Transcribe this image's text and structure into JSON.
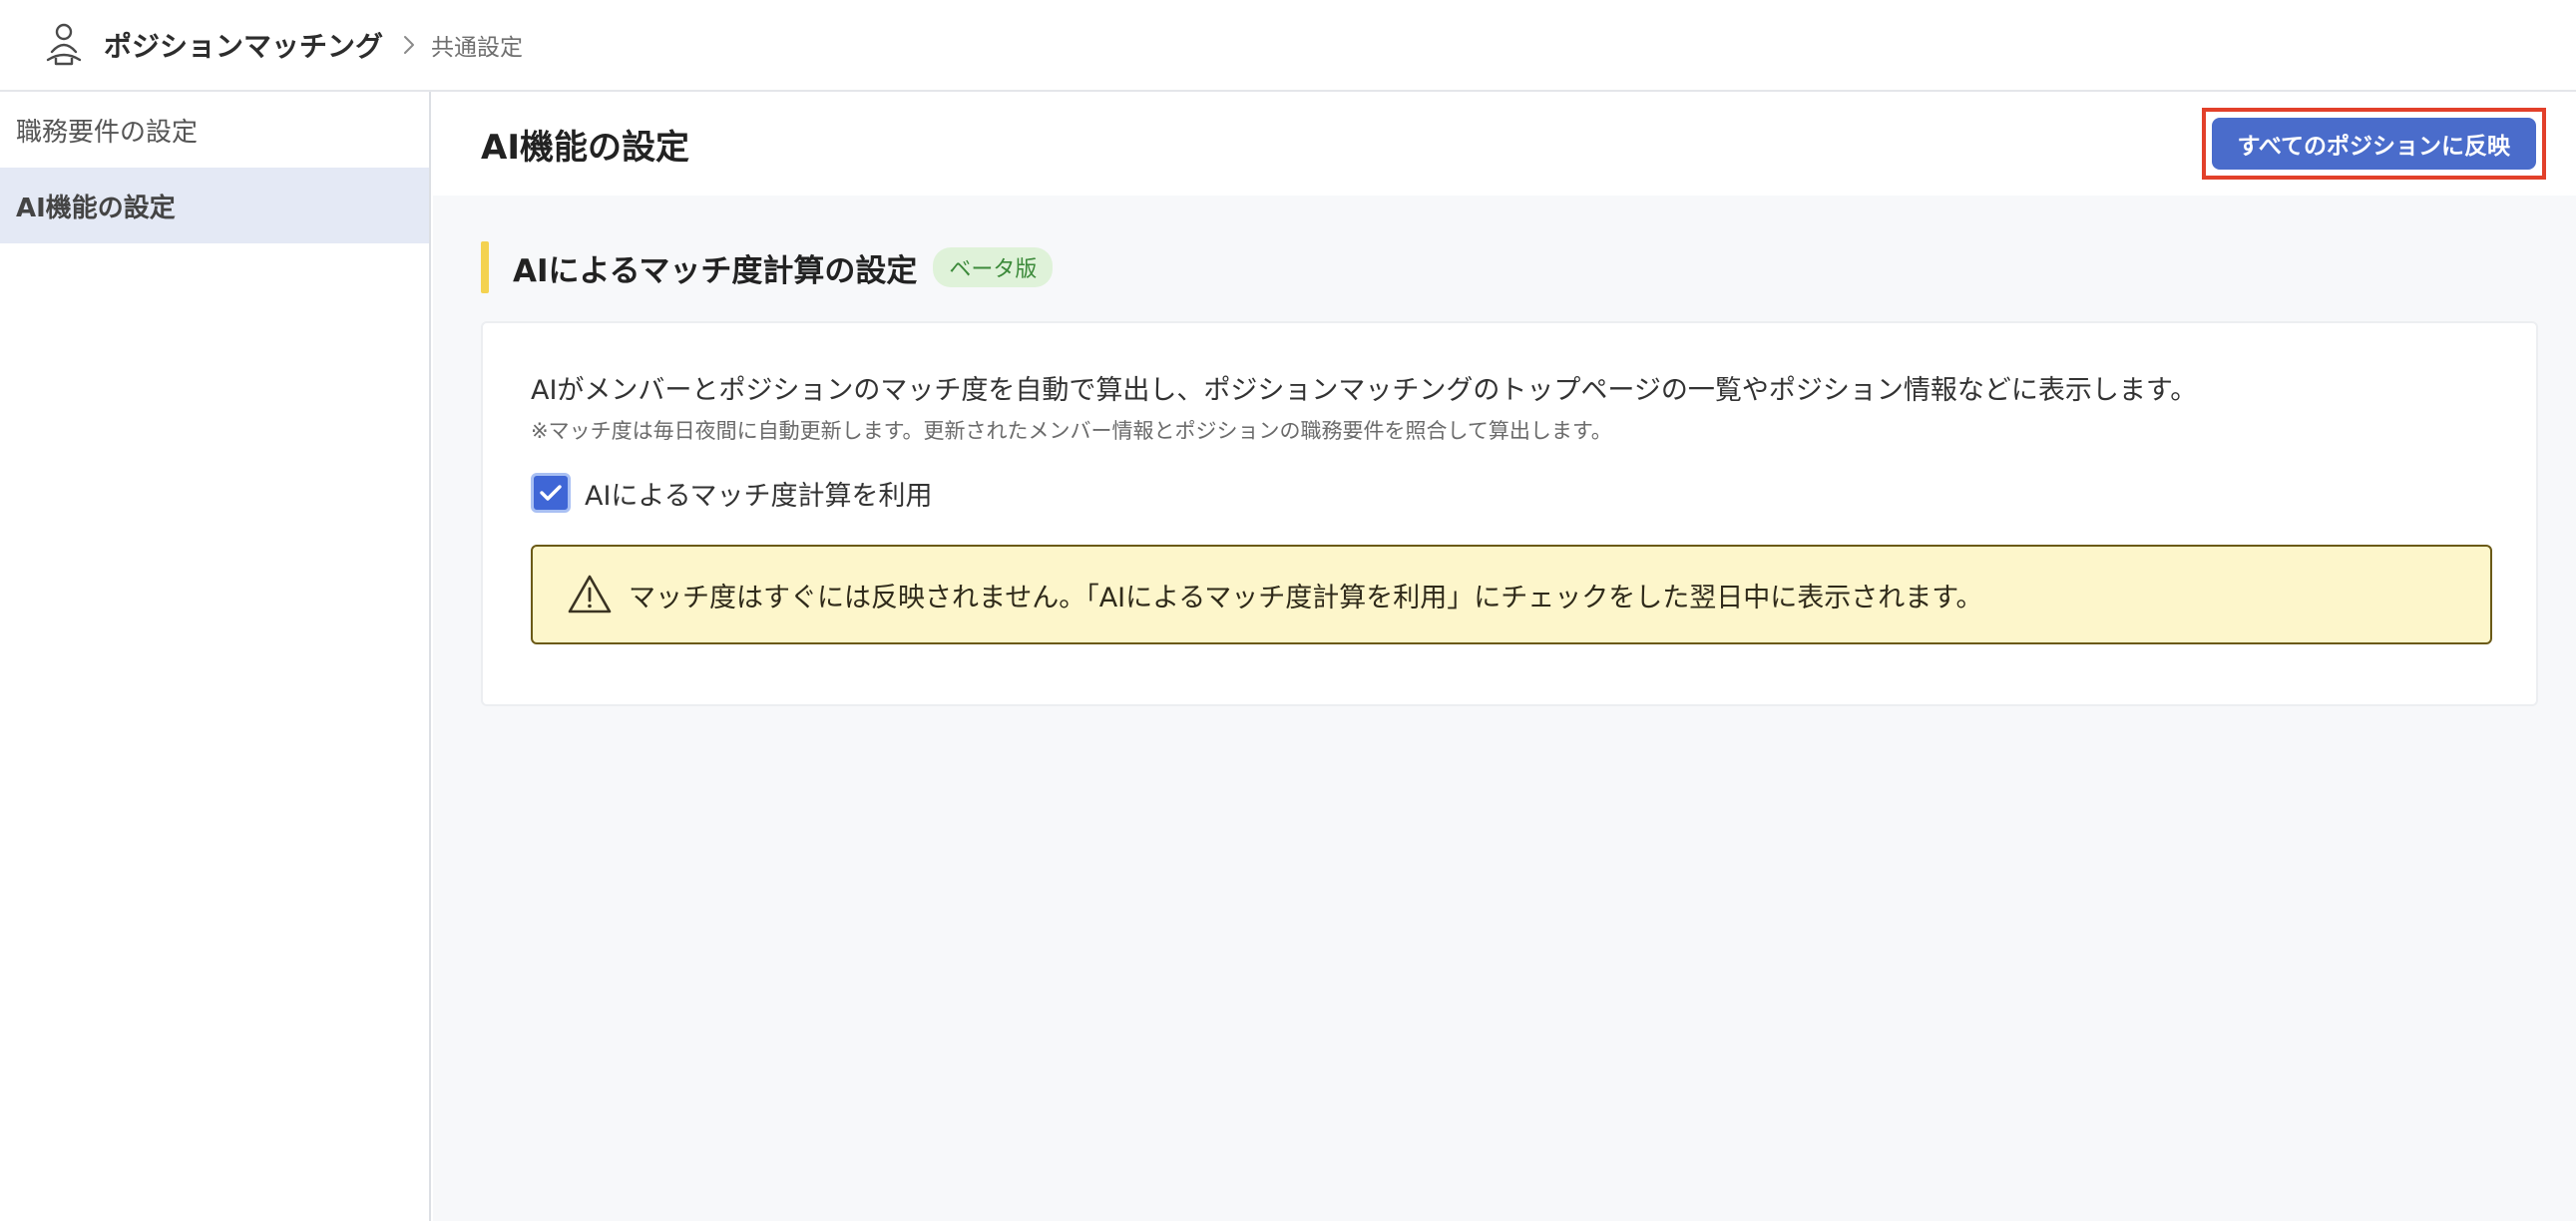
{
  "header": {
    "app_title": "ポジションマッチング",
    "breadcrumb": "共通設定",
    "logo_icon": "person-meditate-icon",
    "separator_icon": "chevron-right-icon"
  },
  "sidebar": {
    "items": [
      {
        "label": "職務要件の設定",
        "active": false
      },
      {
        "label": "AI機能の設定",
        "active": true
      }
    ]
  },
  "main": {
    "page_title": "AI機能の設定",
    "apply_button_label": "すべてのポジションに反映",
    "section": {
      "title": "AIによるマッチ度計算の設定",
      "badge": "ベータ版",
      "description": "AIがメンバーとポジションのマッチ度を自動で算出し、ポジションマッチングのトップページの一覧やポジション情報などに表示します。",
      "note": "※マッチ度は毎日夜間に自動更新します。更新されたメンバー情報とポジションの職務要件を照合して算出します。",
      "checkbox_label": "AIによるマッチ度計算を利用",
      "checkbox_checked": true,
      "warning_text": "マッチ度はすぐには反映されません。「AIによるマッチ度計算を利用」にチェックをした翌日中に表示されます。",
      "warning_icon": "warning-triangle-icon"
    }
  },
  "colors": {
    "accent_button": "#4a6ccb",
    "highlight_frame": "#e2402a",
    "heading_bar": "#f4d250",
    "badge_bg": "#dff2d9",
    "badge_text": "#3c8a3a",
    "warning_bg": "#fdf6cb",
    "sidebar_active_bg": "#e4e9f5"
  }
}
